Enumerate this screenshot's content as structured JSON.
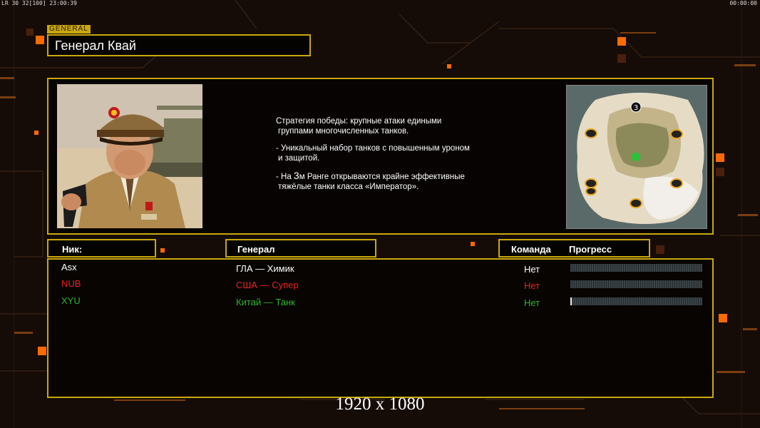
{
  "status": {
    "left": "LR 30 32[100] 23:00:39",
    "right": "00:00:00"
  },
  "general_tag": "GENERAL",
  "general_name": "Генерал Квай",
  "description": {
    "line1": "Стратегия победы: крупные атаки едиными",
    "line2": "группами многочисленных танков.",
    "line3": "- Уникальный набор танков с повышенным уроном",
    "line4": "и защитой.",
    "line5_pre": "- На ",
    "line5_num": "3",
    "line5_post": "м Ранге открываются крайне эффективные",
    "line6": "тяжёлые танки класса «Император»."
  },
  "map": {
    "player_count_badge": "3"
  },
  "headers": {
    "nick": "Ник:",
    "general": "Генерал",
    "team": "Команда",
    "progress": "Прогресс"
  },
  "players": [
    {
      "nick": "Asx",
      "general": "ГЛА — Химик",
      "team": "Нет",
      "color": "#ffffff",
      "progress": 0.0
    },
    {
      "nick": "NUB",
      "general": "США — Супер",
      "team": "Нет",
      "color": "#e8231d",
      "progress": 0.0
    },
    {
      "nick": "XYU",
      "general": "Китай — Танк",
      "team": "Нет",
      "color": "#2fb52f",
      "progress": 0.01
    }
  ],
  "resolution_label": "1920 x 1080",
  "colors": {
    "accent": "#c9a80e",
    "orange": "#ff6a00"
  }
}
